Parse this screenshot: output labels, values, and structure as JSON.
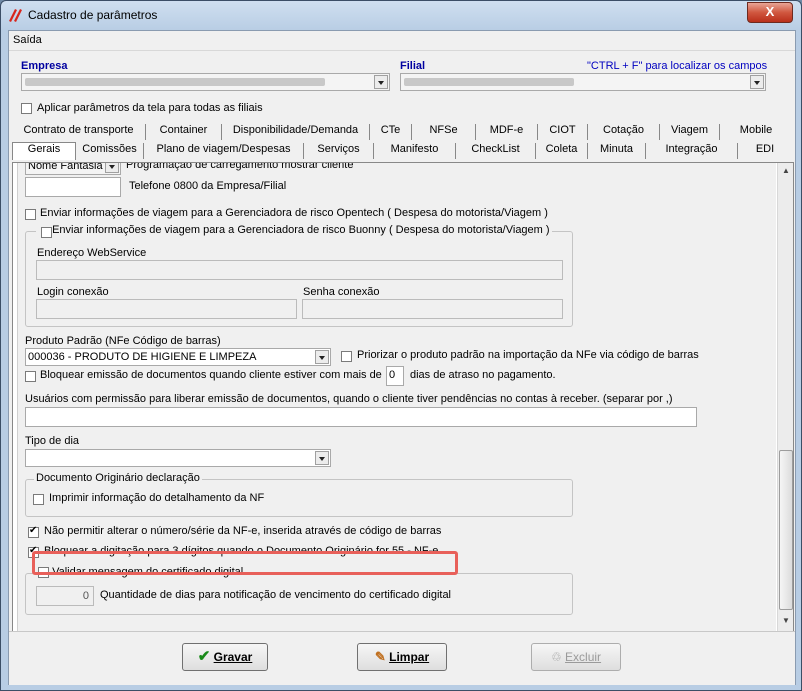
{
  "window": {
    "title": "Cadastro de parâmetros",
    "close_glyph": "X"
  },
  "menu": {
    "saida": "Saída"
  },
  "header": {
    "empresa_label": "Empresa",
    "filial_label": "Filial",
    "hint": "\"CTRL + F\" para localizar os campos",
    "apply_all": "Aplicar parâmetros da tela para todas as filiais"
  },
  "tabs_row1": [
    "Contrato de transporte",
    "Container",
    "Disponibilidade/Demanda",
    "CTe",
    "NFSe",
    "MDF-e",
    "CIOT",
    "Cotação",
    "Viagem",
    "Mobile"
  ],
  "tabs_row2": [
    "Gerais",
    "Comissões",
    "Plano de viagem/Despesas",
    "Serviços",
    "Manifesto",
    "CheckList",
    "Coleta",
    "Minuta",
    "Integração",
    "EDI"
  ],
  "active_tab": "Gerais",
  "form": {
    "nome_fantasia": "Nome Fantasia",
    "programacao": "Programação de carregamento mostrar cliente",
    "telefone": "Telefone 0800 da Empresa/Filial",
    "opentech": "Enviar informações de viagem para a Gerenciadora de risco Opentech ( Despesa do motorista/Viagem )",
    "buonny": "Enviar informações de viagem para a Gerenciadora de risco Buonny ( Despesa do motorista/Viagem )",
    "endereco_ws": "Endereço WebService",
    "login": "Login conexão",
    "senha": "Senha conexão",
    "produto_label": "Produto Padrão (NFe Código de barras)",
    "produto_value": "000036 - PRODUTO DE HIGIENE E LIMPEZA",
    "priorizar": "Priorizar o produto padrão na importação da NFe via código de barras",
    "bloquear_prefix": "Bloquear emissão de documentos quando cliente estiver com mais de",
    "bloquear_value": "0",
    "bloquear_suffix": "dias de atraso no pagamento.",
    "usuarios": "Usuários com permissão para liberar emissão de documentos, quando o cliente tiver pendências no contas à receber. (separar por ,)",
    "tipo_dia": "Tipo de dia",
    "doc_group": "Documento Originário declaração",
    "imprimir": "Imprimir informação do detalhamento da NF",
    "nao_permitir": "Não permitir alterar o número/série da NF-e, inserida através de código de barras",
    "bloquear_digitacao": "Bloquear a digitação para 3 dígitos quando o Documento Originário for 55 - NF-e",
    "validar": "Validar mensagem do certificado digital",
    "dias_value": "0",
    "dias_label": "Quantidade de dias para notificação de vencimento do certificado digital"
  },
  "buttons": {
    "gravar": "Gravar",
    "limpar": "Limpar",
    "excluir": "Excluir"
  },
  "colors": {
    "highlight": "#e8605a",
    "label_blue": "#0000a0"
  }
}
